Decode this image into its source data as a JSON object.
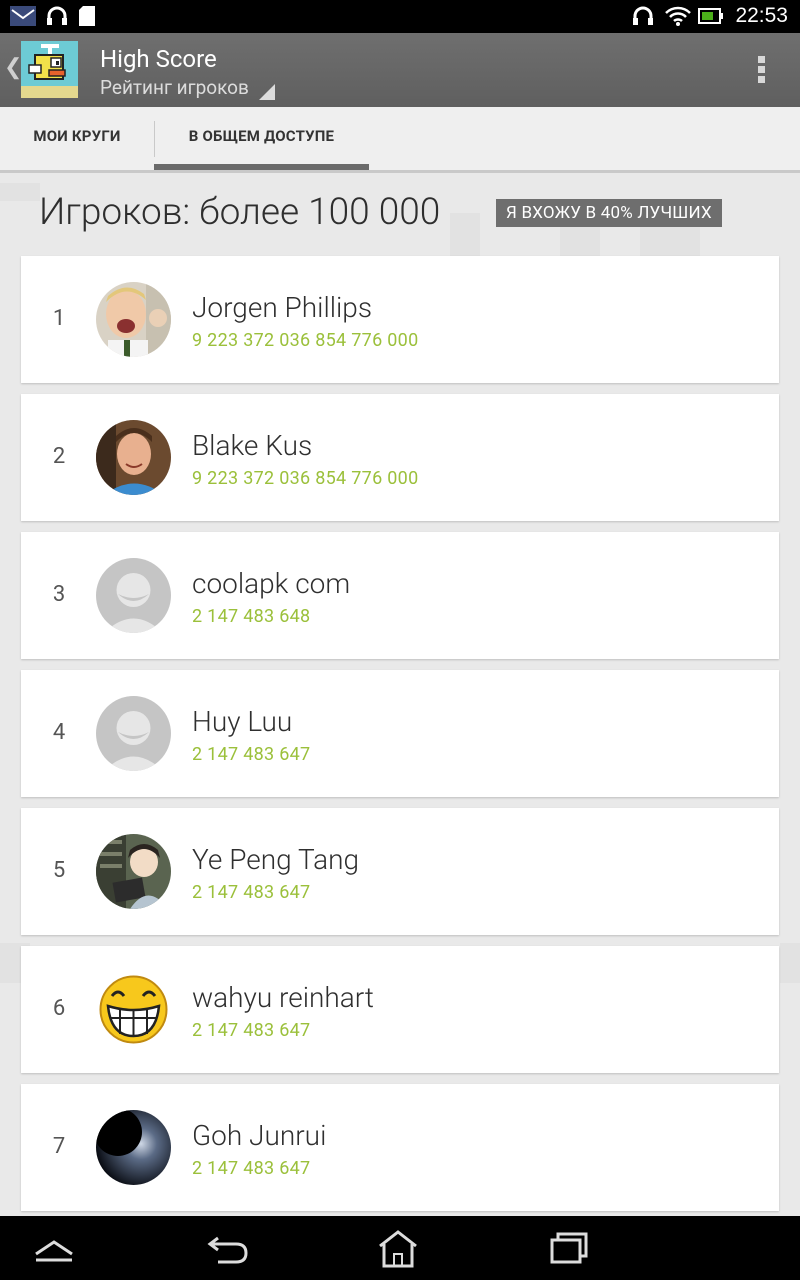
{
  "status_bar": {
    "time": "22:53",
    "icons": [
      "mail-icon",
      "headphones-icon",
      "sd-card-icon",
      "headphones-icon",
      "wifi-icon",
      "battery-icon"
    ]
  },
  "action_bar": {
    "title": "High Score",
    "subtitle": "Рейтинг игроков",
    "icons": [
      "back-chevron-icon",
      "app-logo-icon",
      "dropdown-triangle-icon",
      "overflow-menu-icon"
    ]
  },
  "tabs": [
    {
      "label": "МОИ КРУГИ",
      "selected": false
    },
    {
      "label": "В ОБЩЕМ ДОСТУПЕ",
      "selected": true
    }
  ],
  "summary": {
    "players": "Игроков: более 100 000",
    "badge": "Я ВХОЖУ В 40% ЛУЧШИХ"
  },
  "leaderboard": [
    {
      "rank": "1",
      "name": "Jorgen Phillips",
      "score": "9 223 372 036 854 776 000",
      "avatar": "photo-avatar"
    },
    {
      "rank": "2",
      "name": "Blake Kus",
      "score": "9 223 372 036 854 776 000",
      "avatar": "photo-avatar"
    },
    {
      "rank": "3",
      "name": "coolapk com",
      "score": "2 147 483 648",
      "avatar": "default-avatar"
    },
    {
      "rank": "4",
      "name": "Huy Luu",
      "score": "2 147 483 647",
      "avatar": "default-avatar"
    },
    {
      "rank": "5",
      "name": "Ye Peng Tang",
      "score": "2 147 483 647",
      "avatar": "anime-avatar"
    },
    {
      "rank": "6",
      "name": "wahyu reinhart",
      "score": "2 147 483 647",
      "avatar": "smiley-avatar"
    },
    {
      "rank": "7",
      "name": "Goh Junrui",
      "score": "2 147 483 647",
      "avatar": "eclipse-avatar"
    }
  ],
  "nav_bar": {
    "icons": [
      "up-chevron-icon",
      "back-icon",
      "home-icon",
      "recent-apps-icon"
    ]
  },
  "colors": {
    "score_text": "#9bc03b",
    "action_bar": "#676767",
    "badge_bg": "#6e6e6e"
  }
}
